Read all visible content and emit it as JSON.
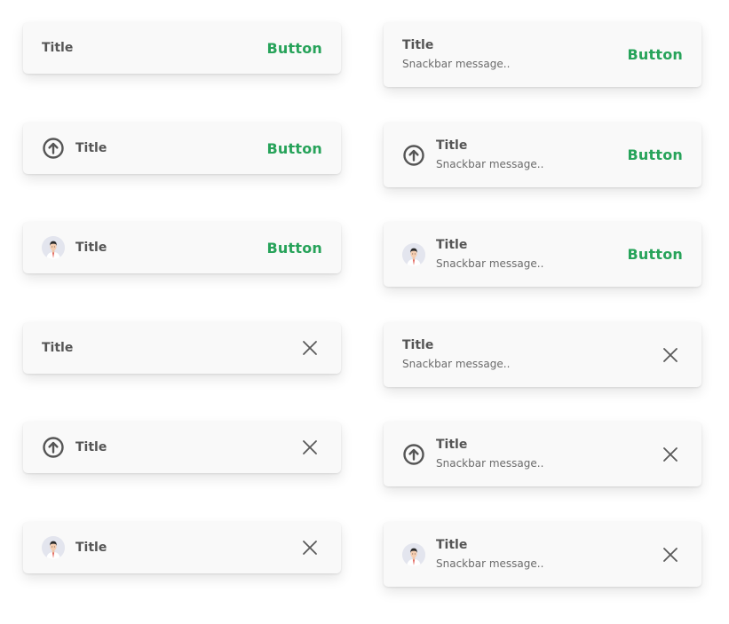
{
  "colors": {
    "card_background": "#f9f9f9",
    "title": "#555555",
    "message": "#6b6b6b",
    "action": "#27a35a",
    "icon": "#555555"
  },
  "snackbars": {
    "r1c1": {
      "title": "Title",
      "action": "Button"
    },
    "r1c2": {
      "title": "Title",
      "message": "Snackbar message..",
      "action": "Button"
    },
    "r2c1": {
      "icon": "arrow-up-circle-icon",
      "title": "Title",
      "action": "Button"
    },
    "r2c2": {
      "icon": "arrow-up-circle-icon",
      "title": "Title",
      "message": "Snackbar message..",
      "action": "Button"
    },
    "r3c1": {
      "icon": "avatar",
      "title": "Title",
      "action": "Button"
    },
    "r3c2": {
      "icon": "avatar",
      "title": "Title",
      "message": "Snackbar message..",
      "action": "Button"
    },
    "r4c1": {
      "title": "Title",
      "dismiss": "close-icon"
    },
    "r4c2": {
      "title": "Title",
      "message": "Snackbar message..",
      "dismiss": "close-icon"
    },
    "r5c1": {
      "icon": "arrow-up-circle-icon",
      "title": "Title",
      "dismiss": "close-icon"
    },
    "r5c2": {
      "icon": "arrow-up-circle-icon",
      "title": "Title",
      "message": "Snackbar message..",
      "dismiss": "close-icon"
    },
    "r6c1": {
      "icon": "avatar",
      "title": "Title",
      "dismiss": "close-icon"
    },
    "r6c2": {
      "icon": "avatar",
      "title": "Title",
      "message": "Snackbar message..",
      "dismiss": "close-icon"
    }
  }
}
